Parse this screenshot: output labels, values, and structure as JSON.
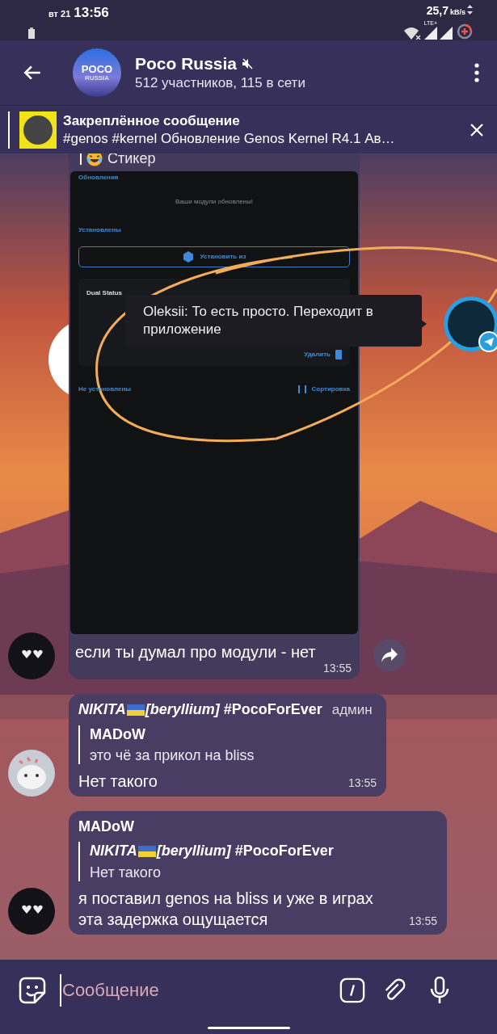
{
  "status_bar": {
    "day": "вт 21",
    "time": "13:56",
    "speed": "25,7",
    "speed_unit": "kB/s",
    "network": "LTE+"
  },
  "header": {
    "avatar_line1": "POCO",
    "avatar_line2": "RUSSIA",
    "title": "Poco Russia",
    "muted": true,
    "subtitle": "512 участников, 115 в сети"
  },
  "pinned": {
    "title": "Закреплённое сообщение",
    "text": "#genos #kernel Обновление Genos Kernel R4.1 Ав…"
  },
  "messages": [
    {
      "kind": "screenshot",
      "reply_text": "Стикер",
      "screen": {
        "section1": "Обновления",
        "notice": "Ваши модули обновлены!",
        "section2": "Установлены",
        "install_button": "Установить из",
        "module_name": "Dual Status",
        "delete_button": "Удалить",
        "section3": "Не установлены",
        "sort_button": "Сортировка"
      },
      "text": "если ты думал про модули - нет",
      "time": "13:55"
    },
    {
      "kind": "reply",
      "sender_parts": [
        "NIKITA",
        "*[beryllium]* #PocoForEver"
      ],
      "badge": "админ",
      "reply_sender": "MADoW",
      "reply_text": "это чё за прикол на bliss",
      "text": "Нет такого",
      "time": "13:55"
    },
    {
      "kind": "reply",
      "sender": "MADoW",
      "reply_sender_parts": [
        "NIKITA",
        "*[beryllium]* #PocoForEver"
      ],
      "reply_text": "Нет такого",
      "text": "я поставил genos на bliss и уже в играх эта задержка ощущается",
      "time": "13:55"
    }
  ],
  "tooltip": "Oleksii: То есть просто. Переходит в приложение",
  "composer": {
    "placeholder": "Сообщение"
  }
}
